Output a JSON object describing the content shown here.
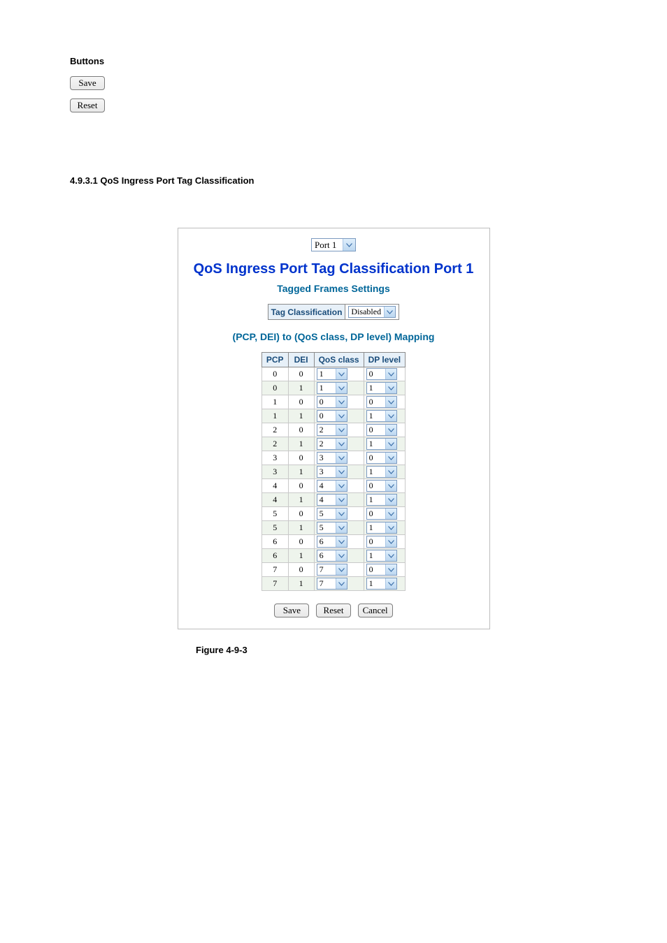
{
  "buttons_heading": "Buttons",
  "top_buttons": {
    "save": "Save",
    "reset": "Reset"
  },
  "section_title": "4.9.3.1 QoS Ingress Port Tag Classification",
  "port_select": {
    "label": "Port 1"
  },
  "panel_title": "QoS Ingress Port Tag Classification  Port 1",
  "tagged_frames_title": "Tagged Frames Settings",
  "tag_classification": {
    "label": "Tag Classification",
    "value": "Disabled"
  },
  "mapping_title": "(PCP, DEI) to (QoS class, DP level) Mapping",
  "columns": {
    "pcp": "PCP",
    "dei": "DEI",
    "qos": "QoS class",
    "dp": "DP level"
  },
  "rows": [
    {
      "pcp": "0",
      "dei": "0",
      "qos": "1",
      "dp": "0"
    },
    {
      "pcp": "0",
      "dei": "1",
      "qos": "1",
      "dp": "1"
    },
    {
      "pcp": "1",
      "dei": "0",
      "qos": "0",
      "dp": "0"
    },
    {
      "pcp": "1",
      "dei": "1",
      "qos": "0",
      "dp": "1"
    },
    {
      "pcp": "2",
      "dei": "0",
      "qos": "2",
      "dp": "0"
    },
    {
      "pcp": "2",
      "dei": "1",
      "qos": "2",
      "dp": "1"
    },
    {
      "pcp": "3",
      "dei": "0",
      "qos": "3",
      "dp": "0"
    },
    {
      "pcp": "3",
      "dei": "1",
      "qos": "3",
      "dp": "1"
    },
    {
      "pcp": "4",
      "dei": "0",
      "qos": "4",
      "dp": "0"
    },
    {
      "pcp": "4",
      "dei": "1",
      "qos": "4",
      "dp": "1"
    },
    {
      "pcp": "5",
      "dei": "0",
      "qos": "5",
      "dp": "0"
    },
    {
      "pcp": "5",
      "dei": "1",
      "qos": "5",
      "dp": "1"
    },
    {
      "pcp": "6",
      "dei": "0",
      "qos": "6",
      "dp": "0"
    },
    {
      "pcp": "6",
      "dei": "1",
      "qos": "6",
      "dp": "1"
    },
    {
      "pcp": "7",
      "dei": "0",
      "qos": "7",
      "dp": "0"
    },
    {
      "pcp": "7",
      "dei": "1",
      "qos": "7",
      "dp": "1"
    }
  ],
  "bottom_buttons": {
    "save": "Save",
    "reset": "Reset",
    "cancel": "Cancel"
  },
  "figure_caption": "Figure 4-9-3"
}
